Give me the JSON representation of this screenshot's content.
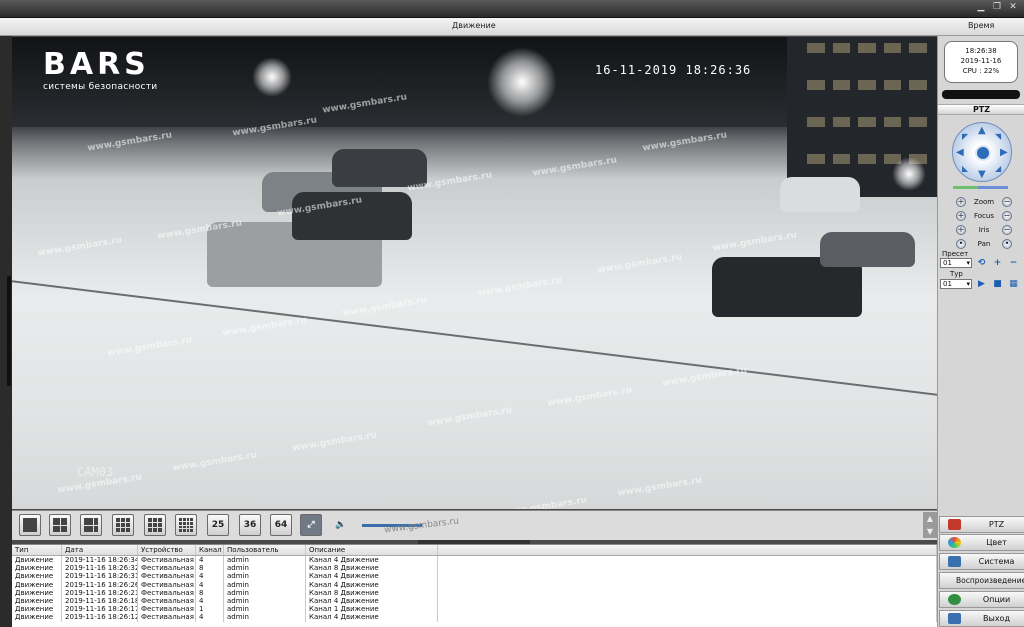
{
  "menu": {
    "motion_label": "Движение",
    "time_label": "Время"
  },
  "video": {
    "logo": {
      "brand": "BARS",
      "tagline": "системы безопасности"
    },
    "osd_timestamp": "16-11-2019 18:26:36",
    "camera_label": "CAM03",
    "watermark": "www.gsmbars.ru"
  },
  "clock": {
    "time": "18:26:38",
    "date": "2019-11-16",
    "cpu": "CPU : 22%"
  },
  "ptz": {
    "title": "PTZ",
    "controls": [
      "Zoom",
      "Focus",
      "Iris",
      "Pan"
    ],
    "preset_label": "Пресет",
    "preset_value": "01",
    "tour_label": "Тур",
    "tour_value": "01"
  },
  "toolbar": {
    "layouts": [
      "1",
      "4",
      "6",
      "8",
      "9",
      "16",
      "25",
      "36",
      "64"
    ]
  },
  "nav": [
    {
      "label": "PTZ",
      "icon": "ptz-icon",
      "color": "#c0392b"
    },
    {
      "label": "Цвет",
      "icon": "color-icon",
      "color": "#3c8f3c"
    },
    {
      "label": "Система",
      "icon": "system-icon",
      "color": "#3a6fb0"
    },
    {
      "label": "Воспроизведение",
      "icon": "playback-icon",
      "color": "#c0392b"
    },
    {
      "label": "Опции",
      "icon": "options-icon",
      "color": "#2f8f3f"
    },
    {
      "label": "Выход",
      "icon": "exit-icon",
      "color": "#3a6fb0"
    }
  ],
  "log": {
    "headers": [
      "Тип",
      "Дата",
      "Устройство",
      "Канал",
      "Пользователь",
      "Описание"
    ],
    "rows": [
      [
        "Движение",
        "2019-11-16 18:26:34",
        "Фестивальная",
        "4",
        "admin",
        "Канал 4 Движение"
      ],
      [
        "Движение",
        "2019-11-16 18:26:32",
        "Фестивальная",
        "8",
        "admin",
        "Канал 8 Движение"
      ],
      [
        "Движение",
        "2019-11-16 18:26:31",
        "Фестивальная",
        "4",
        "admin",
        "Канал 4 Движение"
      ],
      [
        "Движение",
        "2019-11-16 18:26:26",
        "Фестивальная",
        "4",
        "admin",
        "Канал 4 Движение"
      ],
      [
        "Движение",
        "2019-11-16 18:26:21",
        "Фестивальная",
        "8",
        "admin",
        "Канал 8 Движение"
      ],
      [
        "Движение",
        "2019-11-16 18:26:18",
        "Фестивальная",
        "4",
        "admin",
        "Канал 4 Движение"
      ],
      [
        "Движение",
        "2019-11-16 18:26:17",
        "Фестивальная",
        "1",
        "admin",
        "Канал 1 Движение"
      ],
      [
        "Движение",
        "2019-11-16 18:26:12",
        "Фестивальная",
        "4",
        "admin",
        "Канал 4 Движение"
      ]
    ]
  }
}
